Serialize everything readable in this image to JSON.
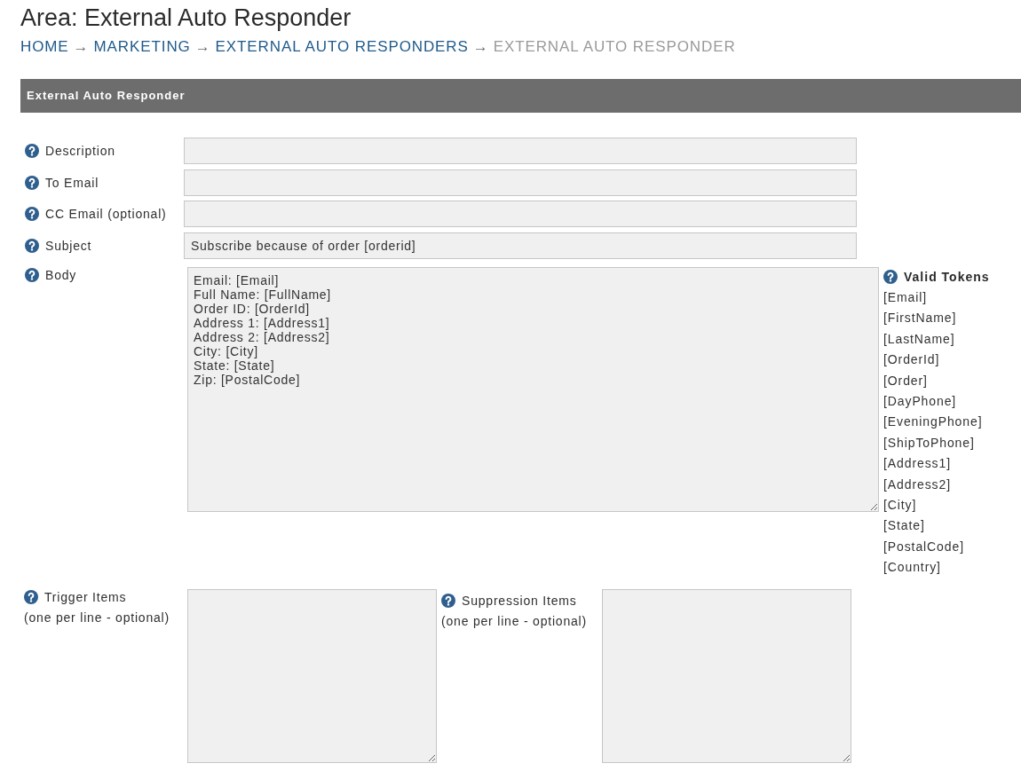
{
  "page": {
    "title": "Area: External Auto Responder"
  },
  "breadcrumb": [
    {
      "kind": "link",
      "label": "HOME"
    },
    {
      "kind": "separator",
      "label": "→"
    },
    {
      "kind": "link",
      "label": "MARKETING"
    },
    {
      "kind": "separator",
      "label": "→"
    },
    {
      "kind": "link",
      "label": "EXTERNAL AUTO RESPONDERS"
    },
    {
      "kind": "separator",
      "label": "→"
    },
    {
      "kind": "current",
      "label": "EXTERNAL AUTO RESPONDER"
    }
  ],
  "panel": {
    "title": "External Auto Responder"
  },
  "fields": [
    {
      "kind": "input",
      "label": "Description"
    },
    {
      "kind": "input",
      "label": "To Email"
    },
    {
      "kind": "input",
      "label": "CC Email (optional)"
    },
    {
      "kind": "input",
      "label": "Subject",
      "value": "Subscribe because of order [orderid]"
    },
    {
      "kind": "textarea",
      "label": "Body",
      "value": "Email: [Email]\nFull Name: [FullName]\nOrder ID: [OrderId]\nAddress 1: [Address1]\nAddress 2: [Address2]\nCity: [City]\nState: [State]\nZip: [PostalCode]",
      "tokens": {
        "title": "Valid Tokens",
        "items": [
          "[Email]",
          "[FirstName]",
          "[LastName]",
          "[OrderId]",
          "[Order]",
          "[DayPhone]",
          "[EveningPhone]",
          "[ShipToPhone]",
          "[Address1]",
          "[Address2]",
          "[City]",
          "[State]",
          "[PostalCode]",
          "[Country]"
        ]
      }
    }
  ],
  "list_fields": [
    {
      "label": "Trigger Items",
      "hint": "(one per line - optional)"
    },
    {
      "label": "Suppression Items",
      "hint": "(one per line - optional)"
    }
  ]
}
